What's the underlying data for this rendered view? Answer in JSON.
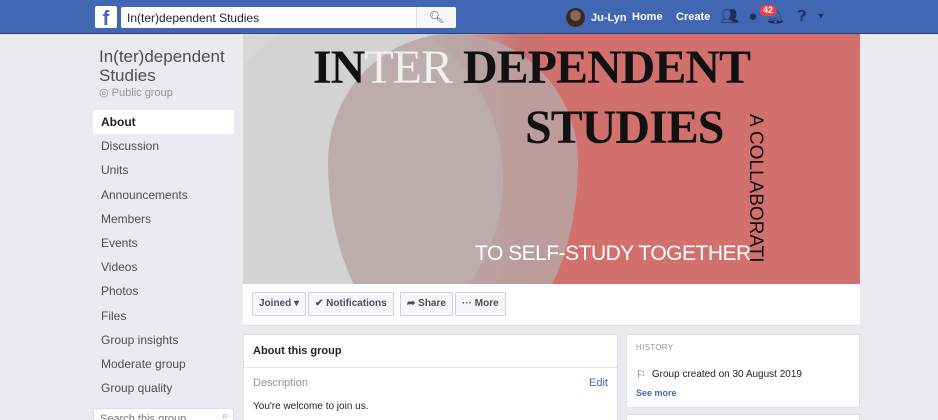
{
  "topbar": {
    "logo": "f",
    "search_value": "In(ter)dependent Studies",
    "user_name": "Ju-Lyn",
    "home": "Home",
    "create": "Create",
    "notif_count": "42",
    "icons": [
      "friends-icon",
      "messenger-icon",
      "notifications-icon",
      "help-icon",
      "menu-caret-icon"
    ]
  },
  "group": {
    "name": "In(ter)dependent Studies",
    "privacy": "Public group"
  },
  "nav": [
    "About",
    "Discussion",
    "Units",
    "Announcements",
    "Members",
    "Events",
    "Videos",
    "Photos",
    "Files",
    "Group insights",
    "Moderate group",
    "Group quality"
  ],
  "side_search_placeholder": "Search this group",
  "cover": {
    "line1_a": "IN",
    "line1_b": "TER",
    "line1_c": " DEPENDENT",
    "line2": "STUDIES",
    "vertical": "A COLLABORATI",
    "bottom": "TO SELF-STUDY TOGETHER"
  },
  "actions": {
    "joined": "Joined ▾",
    "notifications": "✔ Notifications",
    "share": "➦ Share",
    "more": "··· More"
  },
  "about": {
    "title": "About this group",
    "description_label": "Description",
    "edit": "Edit",
    "description_text": "You're welcome to join us."
  },
  "history": {
    "label": "HISTORY",
    "created": "Group created on 30 August 2019",
    "see_more": "See more"
  }
}
